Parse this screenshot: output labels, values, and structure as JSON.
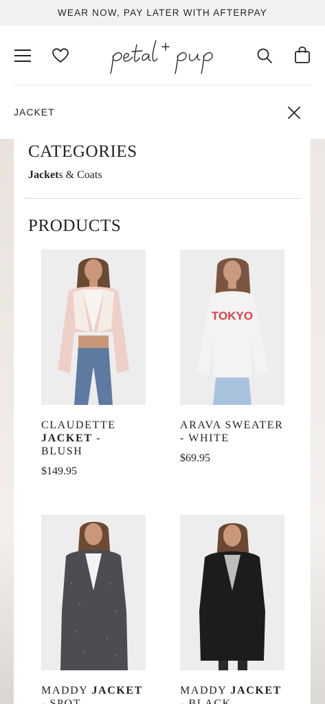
{
  "promo": {
    "text": "WEAR NOW, PAY LATER WITH AFTERPAY"
  },
  "header": {
    "menu_icon": "hamburger-menu-icon",
    "wishlist_icon": "heart-icon",
    "logo_text": "petal + pup",
    "search_icon": "search-icon",
    "cart_icon": "shopping-bag-icon"
  },
  "search": {
    "value": "JACKET",
    "close_icon": "close-icon"
  },
  "categories": {
    "title": "CATEGORIES",
    "items": [
      {
        "match": "Jacket",
        "rest": "s & Coats"
      }
    ]
  },
  "products": {
    "title": "PRODUCTS",
    "items": [
      {
        "name_pre": "CLAUDETTE ",
        "name_match": "JACKET",
        "name_post": " - BLUSH",
        "price": "$149.95"
      },
      {
        "name_pre": "ARAVA SWEATER - WHITE",
        "name_match": "",
        "name_post": "",
        "price": "$69.95",
        "print_text": "TOKYO"
      },
      {
        "name_pre": "MADDY ",
        "name_match": "JACKET",
        "name_post": " - SPOT",
        "price": ""
      },
      {
        "name_pre": "MADDY ",
        "name_match": "JACKET",
        "name_post": " - BLACK",
        "price": ""
      }
    ]
  },
  "colors": {
    "promo_bg": "#f2f2f2",
    "text": "#222222",
    "print_red": "#d9404b"
  }
}
